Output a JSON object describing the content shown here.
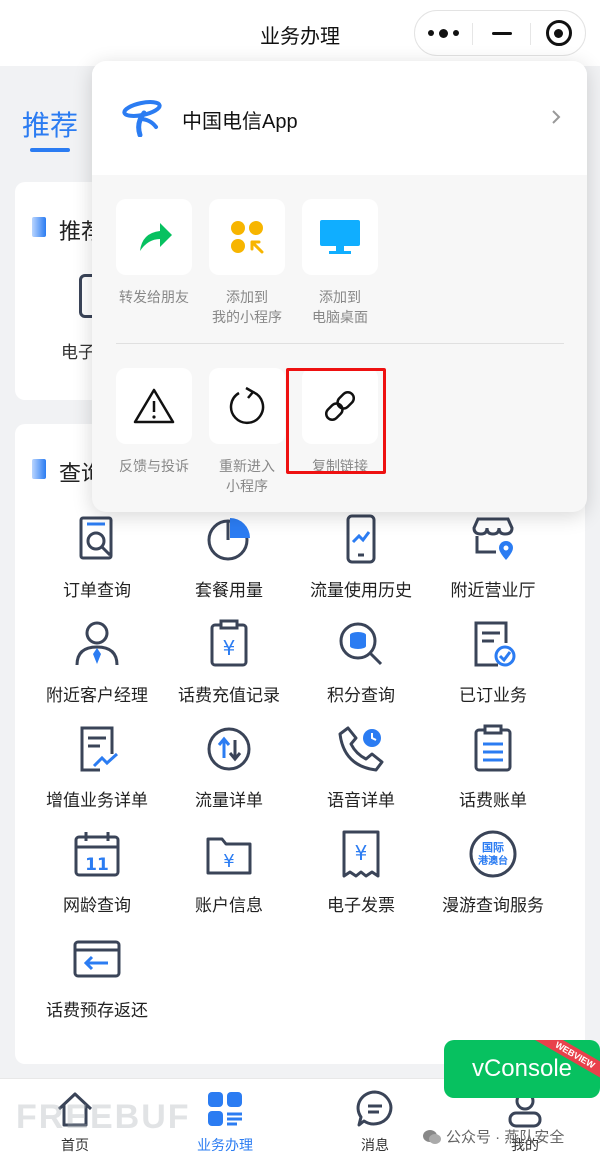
{
  "topbar": {
    "title": "业务办理"
  },
  "tabs": {
    "active": "推荐"
  },
  "card1": {
    "heading": "推荐",
    "partial_item": "电子"
  },
  "card2": {
    "heading": "查询",
    "items": [
      {
        "label": "订单查询",
        "icon": "order-search-icon"
      },
      {
        "label": "套餐用量",
        "icon": "pie-chart-icon"
      },
      {
        "label": "流量使用历史",
        "icon": "phone-chart-icon"
      },
      {
        "label": "附近营业厅",
        "icon": "store-location-icon"
      },
      {
        "label": "附近客户经理",
        "icon": "manager-icon"
      },
      {
        "label": "话费充值记录",
        "icon": "recharge-record-icon"
      },
      {
        "label": "积分查询",
        "icon": "points-search-icon"
      },
      {
        "label": "已订业务",
        "icon": "subscribed-icon"
      },
      {
        "label": "增值业务详单",
        "icon": "value-added-icon"
      },
      {
        "label": "流量详单",
        "icon": "data-detail-icon"
      },
      {
        "label": "语音详单",
        "icon": "voice-detail-icon"
      },
      {
        "label": "话费账单",
        "icon": "bill-icon"
      },
      {
        "label": "网龄查询",
        "icon": "calendar-icon"
      },
      {
        "label": "账户信息",
        "icon": "account-folder-icon"
      },
      {
        "label": "电子发票",
        "icon": "invoice-icon"
      },
      {
        "label": "漫游查询服务",
        "icon": "roaming-icon"
      },
      {
        "label": "话费预存返还",
        "icon": "prepay-return-icon"
      }
    ],
    "roaming_badge": [
      "国际",
      "港澳台"
    ],
    "calendar_day": "11"
  },
  "nav": [
    {
      "label": "首页",
      "icon": "home-icon"
    },
    {
      "label": "业务办理",
      "icon": "apps-icon"
    },
    {
      "label": "消息",
      "icon": "message-icon"
    },
    {
      "label": "我的",
      "icon": "user-icon"
    }
  ],
  "vconsole": {
    "label": "vConsole",
    "ribbon": "WEBVIEW"
  },
  "watermark": "FREEBUF",
  "wechat_source": "公众号 · 燕队安全",
  "popup": {
    "app_name": "中国电信App",
    "share_items": [
      {
        "label": "转发给朋友",
        "icon": "forward-icon"
      },
      {
        "label": "添加到\n我的小程序",
        "icon": "add-mini-program-icon"
      },
      {
        "label": "添加到\n电脑桌面",
        "icon": "desktop-icon"
      }
    ],
    "action_items": [
      {
        "label": "反馈与投诉",
        "icon": "warning-icon"
      },
      {
        "label": "重新进入\n小程序",
        "icon": "reload-icon"
      },
      {
        "label": "复制链接",
        "icon": "link-icon"
      }
    ]
  },
  "colors": {
    "accent": "#2b7cf2",
    "vconsole": "#07c160",
    "highlight": "#e11111",
    "icon_dark": "#3a4458"
  }
}
